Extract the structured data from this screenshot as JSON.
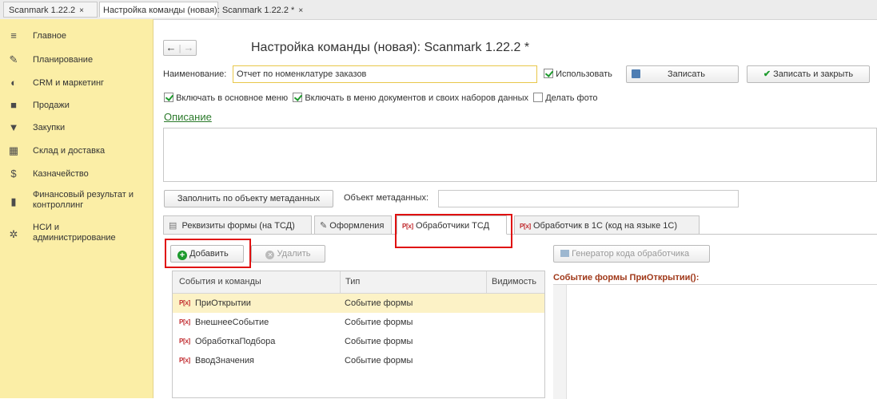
{
  "tabs": [
    {
      "label": "Scanmark 1.22.2",
      "close": "×"
    },
    {
      "label": "Настройка команды (новая): Scanmark 1.22.2 *",
      "close": "×"
    }
  ],
  "sidebar": {
    "items": [
      {
        "label": "Главное",
        "icon": "menu-icon"
      },
      {
        "label": "Планирование",
        "icon": "planning-icon"
      },
      {
        "label": "CRM и маркетинг",
        "icon": "crm-icon"
      },
      {
        "label": "Продажи",
        "icon": "sales-icon"
      },
      {
        "label": "Закупки",
        "icon": "cart-icon"
      },
      {
        "label": "Склад и доставка",
        "icon": "warehouse-icon"
      },
      {
        "label": "Казначейство",
        "icon": "treasury-icon"
      },
      {
        "label": "Финансовый результат и контроллинг",
        "icon": "chart-icon"
      },
      {
        "label": "НСИ и администрирование",
        "icon": "gear-icon"
      }
    ]
  },
  "nav": {
    "back": "←",
    "forward": "→"
  },
  "title": "Настройка команды (новая): Scanmark 1.22.2 *",
  "form": {
    "name_label": "Наименование:",
    "name_value": "Отчет по номенклатуре заказов",
    "use_label": "Использовать",
    "save_label": "Записать",
    "save_close_label": "Записать и закрыть",
    "include_main_menu": "Включать в основное меню",
    "include_docs_menu": "Включать в меню документов и своих наборов данных",
    "take_photo": "Делать фото",
    "description_link": "Описание",
    "fill_by_metadata": "Заполнить по объекту метаданных",
    "metadata_object_label": "Объект метаданных:",
    "metadata_object_value": ""
  },
  "subtabs": [
    {
      "label": "Реквизиты формы (на ТСД)"
    },
    {
      "label": "Оформления"
    },
    {
      "label": "Обработчики ТСД"
    },
    {
      "label": "Обработчик в 1С  (код на языке 1С)"
    }
  ],
  "handlers": {
    "add_label": "Добавить",
    "delete_label": "Удалить",
    "generator_label": "Генератор кода обработчика",
    "code_header": "Событие формы ПриОткрытии():",
    "columns": [
      "События и команды",
      "Тип",
      "Видимость"
    ],
    "rows": [
      {
        "event": "ПриОткрытии",
        "type": "Событие формы"
      },
      {
        "event": "ВнешнееСобытие",
        "type": "Событие формы"
      },
      {
        "event": "ОбработкаПодбора",
        "type": "Событие формы"
      },
      {
        "event": "ВводЗначения",
        "type": "Событие формы"
      }
    ],
    "row_icon_text": "P[x]"
  },
  "colors": {
    "sidebar": "#fbeea6",
    "highlight": "#e01010",
    "accent_green": "#1d9a2d",
    "link": "#2b7a2b",
    "selected_row": "#fcf2c6",
    "code_header": "#a0391a"
  }
}
